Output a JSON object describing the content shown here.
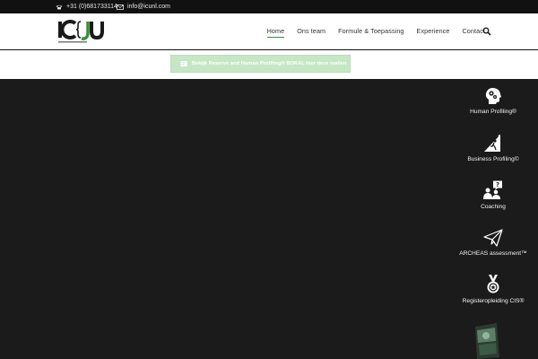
{
  "topbar": {
    "phone": "+31 (0)681733114",
    "email": "info@icunl.com"
  },
  "logo": {
    "text_left": "IC",
    "text_right": "U"
  },
  "nav": {
    "items": [
      {
        "label": "Home"
      },
      {
        "label": "Ons team"
      },
      {
        "label": "Formule & Toepassing"
      },
      {
        "label": "Experience"
      },
      {
        "label": "Contact"
      }
    ]
  },
  "notice": {
    "text": "Bekijk Reserve and Human Profiling® BOKAL hier deze mailen"
  },
  "services": [
    {
      "label": "Human Profiling®",
      "icon": "head-gears-icon"
    },
    {
      "label": "Business Profiling©",
      "icon": "mountain-climber-icon"
    },
    {
      "label": "Coaching",
      "icon": "people-question-icon"
    },
    {
      "label": "ARCHEAS assessment™",
      "icon": "paper-plane-icon"
    },
    {
      "label": "Registeropleiding CIS®",
      "icon": "medal-icon"
    }
  ],
  "colors": {
    "accent": "#3a8f3a",
    "dark_bg": "#1b1b1b",
    "topbar": "#111111",
    "notice_bg": "#c6e7c6"
  }
}
